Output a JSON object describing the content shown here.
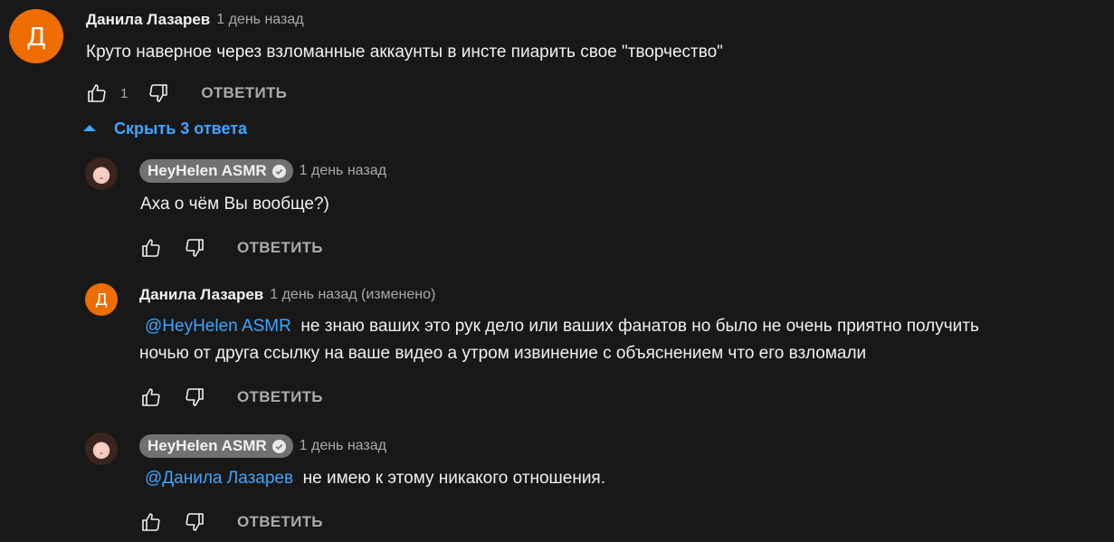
{
  "comment": {
    "avatar_letter": "Д",
    "author": "Данила Лазарев",
    "time": "1 день назад",
    "text": "Круто наверное через взломанные аккаунты в инсте пиарить свое \"творчество\"",
    "likes": "1",
    "reply_label": "ОТВЕТИТЬ"
  },
  "replies_toggle": {
    "label": "Скрыть 3 ответа"
  },
  "replies": [
    {
      "author": "HeyHelen ASMR",
      "verified": true,
      "time": "1 день назад",
      "text": "Аха о чём Вы вообще?)",
      "reply_label": "ОТВЕТИТЬ"
    },
    {
      "avatar_letter": "Д",
      "author": "Данила Лазарев",
      "time": "1 день назад (изменено)",
      "mention": "@HeyHelen ASMR",
      "text_line1": "не знаю ваших это рук дело или ваших фанатов но было не очень приятно получить",
      "text_line2": "ночью от друга ссылку на ваше видео а утром извинение с объяснением что его взломали",
      "reply_label": "ОТВЕТИТЬ"
    },
    {
      "author": "HeyHelen ASMR",
      "verified": true,
      "time": "1 день назад",
      "mention": "@Данила Лазарев",
      "text": "не имею к этому никакого отношения.",
      "reply_label": "ОТВЕТИТЬ"
    }
  ],
  "icons": {
    "like": "thumbs-up-icon",
    "dislike": "thumbs-down-icon",
    "verified": "verified-check-icon",
    "toggle": "collapse-triangle-icon"
  },
  "colors": {
    "background": "#181818",
    "avatar_orange": "#ef6c00",
    "link_blue": "#3ea6ff",
    "muted": "#aaaaaa",
    "chip": "#717171"
  }
}
